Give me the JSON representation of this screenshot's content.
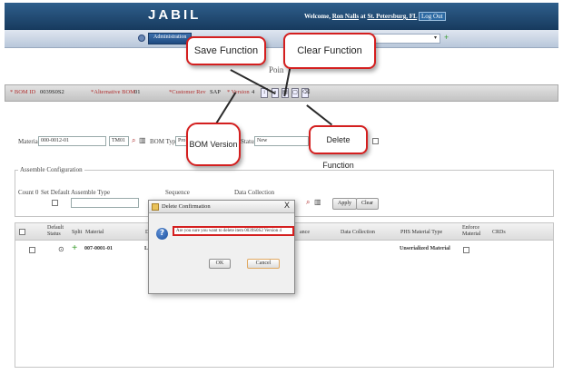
{
  "header": {
    "logo": "JABIL",
    "welcome_prefix": "Welcome,",
    "user": "Ron Nalls",
    "at": "at",
    "site": "St. Petersburg, FL",
    "logout": "Log Out"
  },
  "nav": {
    "admin_tab": "Administration",
    "select_value": ""
  },
  "page": {
    "title_fragment": "Poin"
  },
  "bom_bar": {
    "bom_id_label": "* BOM ID",
    "bom_id_value": "0039S0S2",
    "alt_bom_label": "*Alternative BOM",
    "alt_bom_value": "01",
    "customer_rev_label": "*Customer Rev",
    "customer_rev_value": "SAP",
    "version_label": "* Version",
    "version_value": "4"
  },
  "material_row": {
    "material_label": "Material",
    "material_value": "000-0012-01",
    "rev_value": "TM01",
    "bom_type_label": "BOM Type",
    "bom_type_value": "Pro",
    "status_label": "Status",
    "status_value": "New"
  },
  "assemble": {
    "legend": "Assemble Configuration",
    "count_label": "Count 0",
    "set_default_label": "Set Default",
    "assemble_type_label": "Assemble Type",
    "sequence_label": "Sequence",
    "data_collection_label": "Data Collection",
    "apply_label": "Apply",
    "clear_label": "Clear"
  },
  "grid": {
    "headers": {
      "default_status": "Default Status",
      "split": "Split",
      "material": "Material",
      "d": "D",
      "ance": "ance",
      "data_collection": "Data Collection",
      "phs_material_type": "PHS Material Type",
      "enforce_material": "Enforce Material",
      "crds": "CRDs"
    },
    "row": {
      "material": "007-0001-01",
      "d": "L",
      "phs_material_type": "Unserialized Material"
    }
  },
  "dialog": {
    "title": "Delete Confirmation",
    "close": "X",
    "message": "Are you sure you want to delete item 0039S0S2 Version 4",
    "ok": "OK",
    "cancel": "Cancel"
  },
  "callouts": {
    "save": "Save Function",
    "clear": "Clear Function",
    "bom_version": "BOM Version",
    "delete": "Delete Function"
  },
  "colors": {
    "header_bg": "#1f4a73",
    "callout_border": "#d41f1f",
    "required_label": "#b03030"
  }
}
